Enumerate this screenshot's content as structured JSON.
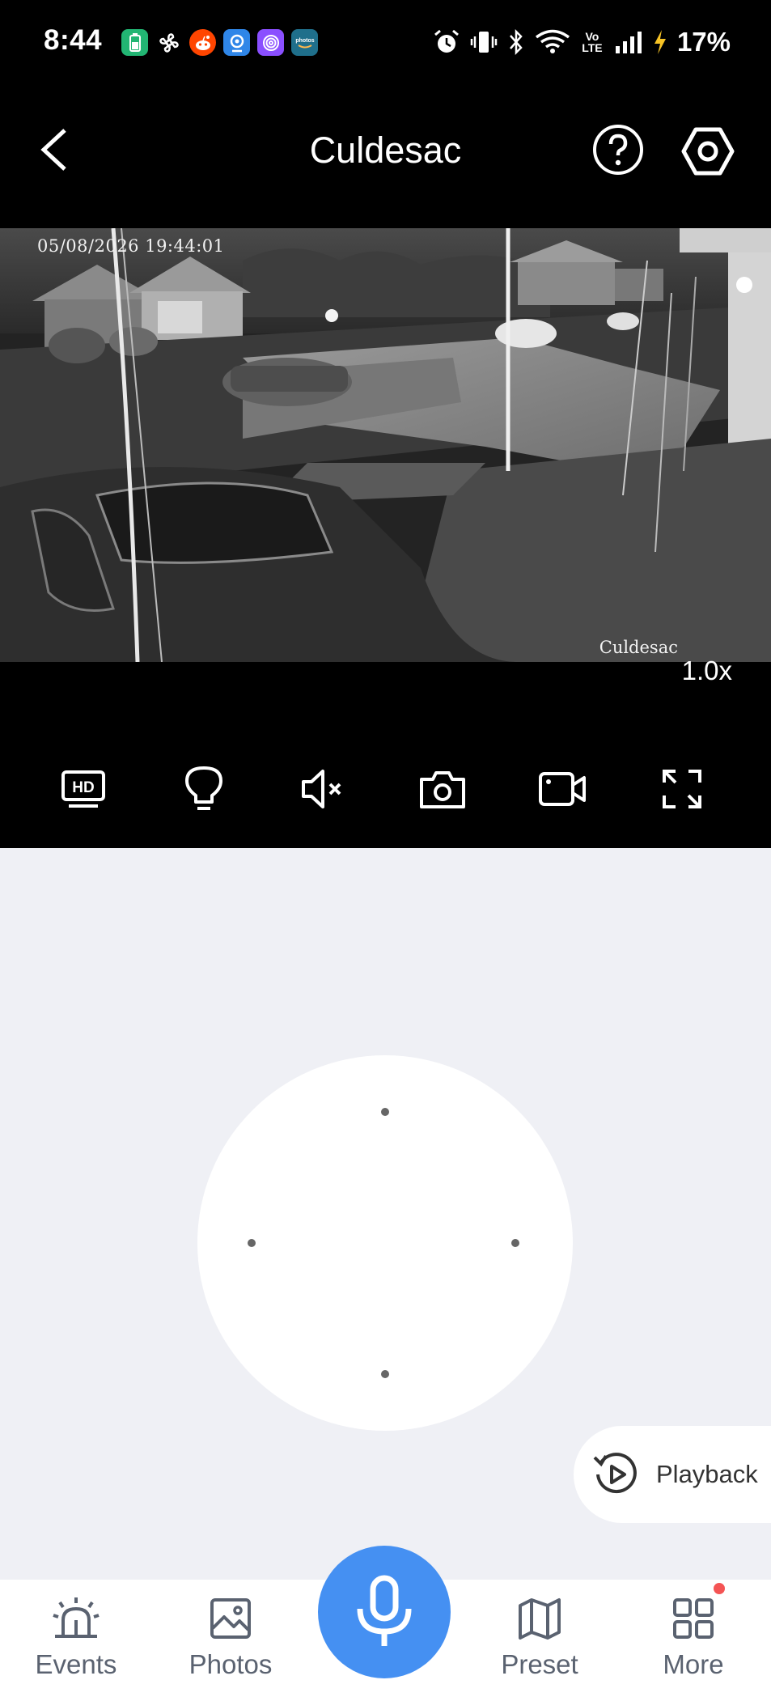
{
  "status_bar": {
    "time": "8:44",
    "battery_percent": "17%",
    "network_label": "Vo LTE",
    "notification_icons": [
      "battery-app-icon",
      "fan-icon",
      "reddit-icon",
      "webcam-app-icon",
      "fingerprint-app-icon",
      "amazon-photos-icon"
    ],
    "system_icons": [
      "alarm-icon",
      "vibrate-icon",
      "bluetooth-icon",
      "wifi-icon",
      "volte-icon",
      "signal-icon",
      "charging-icon"
    ]
  },
  "header": {
    "title": "Culdesac",
    "back_icon": "chevron-left-icon",
    "help_icon": "help-circle-icon",
    "settings_icon": "hexagon-gear-icon"
  },
  "video": {
    "timestamp": "05/08/2026 19:44:01",
    "camera_overlay_name": "Culdesac",
    "zoom": "1.0x"
  },
  "toolbar": {
    "hd_label": "HD",
    "items": [
      "hd-toggle-icon",
      "light-bulb-icon",
      "speaker-muted-icon",
      "camera-snapshot-icon",
      "video-record-icon",
      "fullscreen-icon"
    ]
  },
  "playback": {
    "label": "Playback"
  },
  "bottom_nav": {
    "events": "Events",
    "photos": "Photos",
    "preset": "Preset",
    "more": "More"
  },
  "colors": {
    "accent_blue": "#4590f2",
    "background": "#eff0f5",
    "notification_dot": "#f45454"
  }
}
